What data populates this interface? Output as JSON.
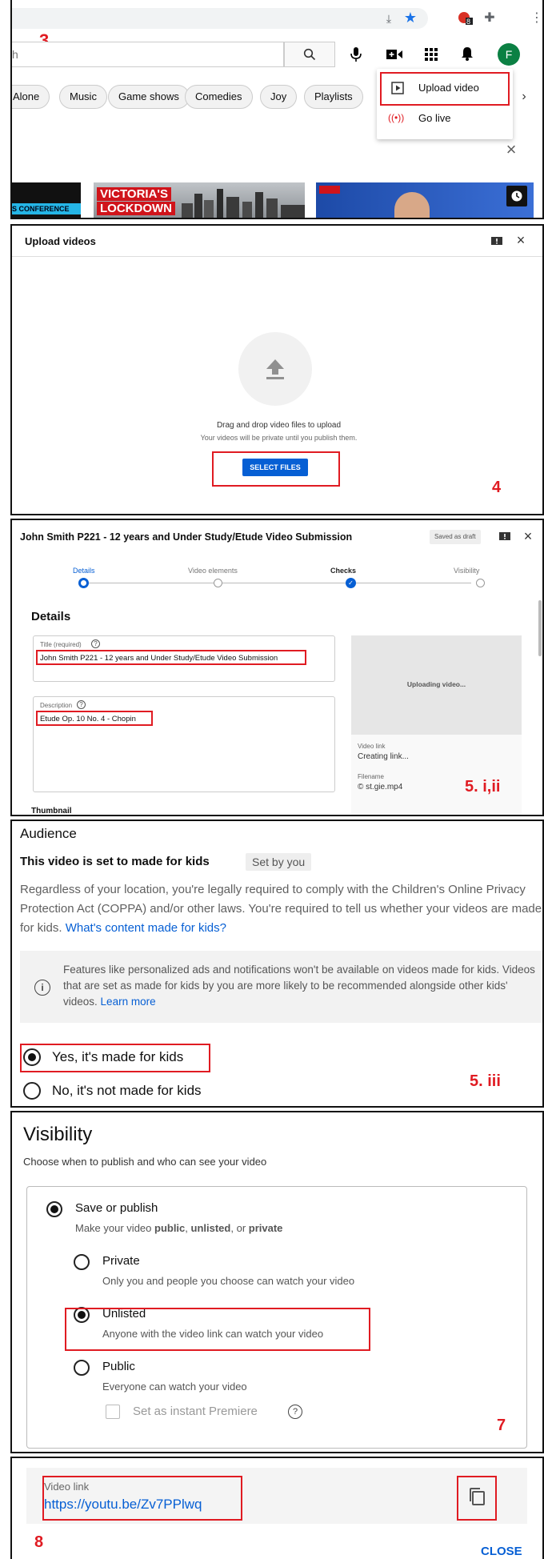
{
  "p1": {
    "step": "3",
    "search_placeholder": "h",
    "avatar_letter": "F",
    "ext_badge": "8",
    "chips": [
      "Alone",
      "Music",
      "Game shows",
      "Comedies",
      "Joy",
      "Playlists"
    ],
    "menu": {
      "upload": "Upload video",
      "live": "Go live"
    },
    "thumb1": "S CONFERENCE",
    "thumb2_line1": "VICTORIA'S",
    "thumb2_line2": "LOCKDOWN"
  },
  "p2": {
    "step": "4",
    "title": "Upload videos",
    "drag": "Drag and drop video files to upload",
    "private_note": "Your videos will be private until you publish them.",
    "select": "SELECT FILES"
  },
  "p3": {
    "step": "5. i,ii",
    "header": "John Smith P221 - 12 years and Under Study/Etude Video Submission",
    "saved": "Saved as draft",
    "steps": [
      "Details",
      "Video elements",
      "Checks",
      "Visibility"
    ],
    "details_heading": "Details",
    "title_label": "Title (required)",
    "title_value": "John Smith P221 - 12 years and Under Study/Etude Video Submission",
    "desc_label": "Description",
    "desc_value": "Etude Op. 10 No. 4 - Chopin",
    "uploading": "Uploading video...",
    "video_link_label": "Video link",
    "video_link_value": "Creating link...",
    "filename_label": "Filename",
    "filename_value": "© st.gie.mp4",
    "thumbnail": "Thumbnail"
  },
  "p4": {
    "step": "5. iii",
    "heading": "Audience",
    "set_line": "This video is set to made for kids",
    "set_by": "Set by you",
    "para": "Regardless of your location, you're legally required to comply with the Children's Online Privacy Protection Act (COPPA) and/or other laws. You're required to tell us whether your videos are made for kids.",
    "para_link": "What's content made for kids?",
    "info": "Features like personalized ads and notifications won't be available on videos made for kids. Videos that are set as made for kids by you are more likely to be recommended alongside other kids' videos.",
    "info_link": "Learn more",
    "yes": "Yes, it's made for kids",
    "no": "No, it's not made for kids"
  },
  "p5": {
    "step": "7",
    "heading": "Visibility",
    "sub": "Choose when to publish and who can see your video",
    "save_publish": "Save or publish",
    "sp_desc_1": "Make your video ",
    "sp_public": "public",
    "sp_comma": ", ",
    "sp_unlisted": "unlisted",
    "sp_or": ", or ",
    "sp_private": "private",
    "private": "Private",
    "private_desc": "Only you and people you choose can watch your video",
    "unlisted": "Unlisted",
    "unlisted_desc": "Anyone with the video link can watch your video",
    "public": "Public",
    "public_desc": "Everyone can watch your video",
    "premiere": "Set as instant Premiere"
  },
  "p6": {
    "step": "8",
    "link_label": "Video link",
    "link_value": "https://youtu.be/Zv7PPlwq",
    "close": "CLOSE"
  }
}
